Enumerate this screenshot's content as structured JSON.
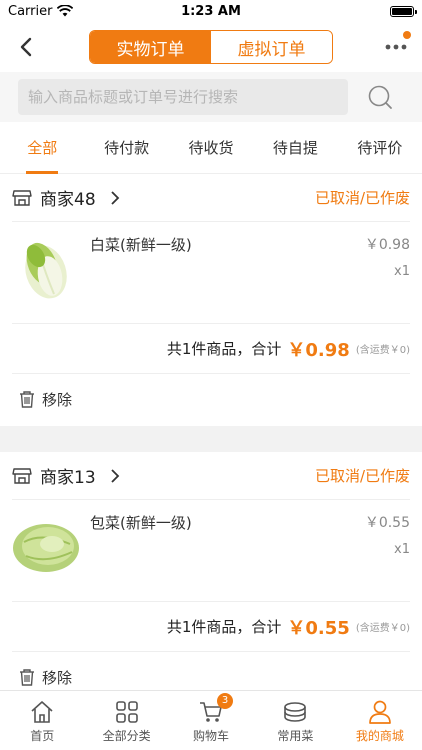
{
  "status_bar": {
    "carrier": "Carrier",
    "time": "1:23 AM"
  },
  "navbar": {
    "segments": [
      "实物订单",
      "虚拟订单"
    ],
    "active_segment": 0
  },
  "search": {
    "placeholder": "输入商品标题或订单号进行搜索",
    "value": ""
  },
  "tabs": [
    "全部",
    "待付款",
    "待收货",
    "待自提",
    "待评价"
  ],
  "active_tab": 0,
  "orders": [
    {
      "shop": "商家48",
      "status": "已取消/已作废",
      "item_name": "白菜(新鲜一级)",
      "price": "￥0.98",
      "qty": "x1",
      "summary_text": "共1件商品，合计",
      "total": "￥0.98",
      "shipping": "(含运费￥0)",
      "remove_label": "移除",
      "image": "napa-cabbage"
    },
    {
      "shop": "商家13",
      "status": "已取消/已作废",
      "item_name": "包菜(新鲜一级)",
      "price": "￥0.55",
      "qty": "x1",
      "summary_text": "共1件商品，合计",
      "total": "￥0.55",
      "shipping": "(含运费￥0)",
      "remove_label": "移除",
      "image": "green-cabbage"
    }
  ],
  "bottom_nav": {
    "items": [
      "首页",
      "全部分类",
      "购物车",
      "常用菜",
      "我的商城"
    ],
    "icons": [
      "home-icon",
      "grid-icon",
      "cart-icon",
      "dish-icon",
      "user-icon"
    ],
    "active": 4,
    "cart_badge": "3"
  },
  "colors": {
    "accent": "#f07b12"
  }
}
